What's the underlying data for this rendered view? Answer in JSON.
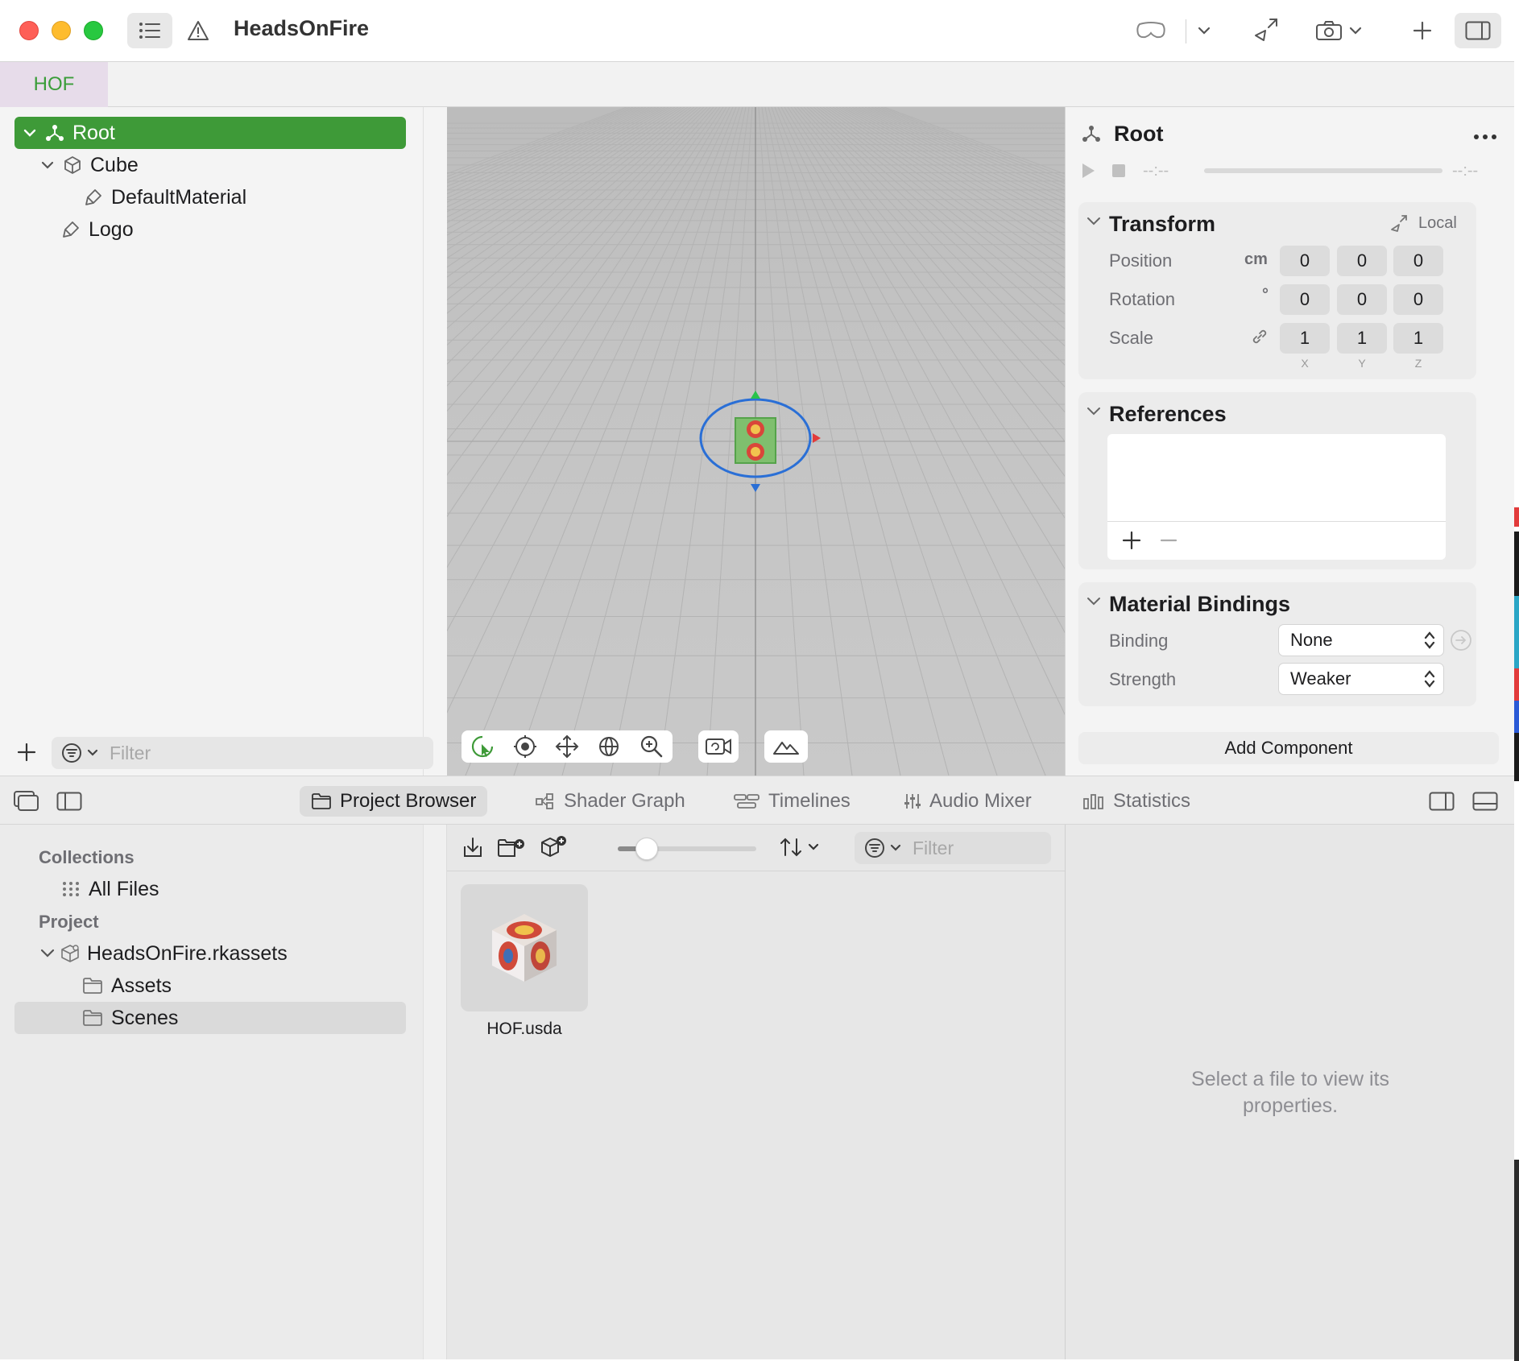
{
  "window": {
    "title": "HeadsOnFire"
  },
  "document_tab": {
    "label": "HOF"
  },
  "hierarchy": {
    "items": [
      {
        "label": "Root",
        "icon": "root-node-icon"
      },
      {
        "label": "Cube",
        "icon": "cube-icon"
      },
      {
        "label": "DefaultMaterial",
        "icon": "material-icon"
      },
      {
        "label": "Logo",
        "icon": "material-icon"
      }
    ],
    "filter_placeholder": "Filter"
  },
  "inspector": {
    "title": "Root",
    "time_start": "--:--",
    "time_end": "--:--",
    "transform": {
      "title": "Transform",
      "space_label": "Local",
      "position_label": "Position",
      "position_unit": "cm",
      "position": [
        "0",
        "0",
        "0"
      ],
      "rotation_label": "Rotation",
      "rotation_unit": "°",
      "rotation": [
        "0",
        "0",
        "0"
      ],
      "scale_label": "Scale",
      "scale": [
        "1",
        "1",
        "1"
      ],
      "axes": [
        "X",
        "Y",
        "Z"
      ]
    },
    "references": {
      "title": "References"
    },
    "material_bindings": {
      "title": "Material Bindings",
      "binding_label": "Binding",
      "binding_value": "None",
      "strength_label": "Strength",
      "strength_value": "Weaker"
    },
    "add_component_label": "Add Component"
  },
  "bottom_tabs": [
    {
      "label": "Project Browser",
      "icon": "folder-icon"
    },
    {
      "label": "Shader Graph",
      "icon": "shader-graph-icon"
    },
    {
      "label": "Timelines",
      "icon": "timelines-icon"
    },
    {
      "label": "Audio Mixer",
      "icon": "audio-mixer-icon"
    },
    {
      "label": "Statistics",
      "icon": "statistics-icon"
    }
  ],
  "collections": {
    "collections_header": "Collections",
    "all_files_label": "All Files",
    "project_header": "Project",
    "package_label": "HeadsOnFire.rkassets",
    "assets_label": "Assets",
    "scenes_label": "Scenes"
  },
  "browser": {
    "filter_placeholder": "Filter",
    "files": [
      {
        "name": "HOF.usda"
      }
    ]
  },
  "file_properties": {
    "placeholder_line1": "Select a file to view its",
    "placeholder_line2": "properties."
  },
  "colors": {
    "accent_green": "#3e9a38",
    "tab_tint": "#e7dcea",
    "close": "#fe5f57",
    "minimize": "#febc2e",
    "zoom": "#28c840"
  }
}
